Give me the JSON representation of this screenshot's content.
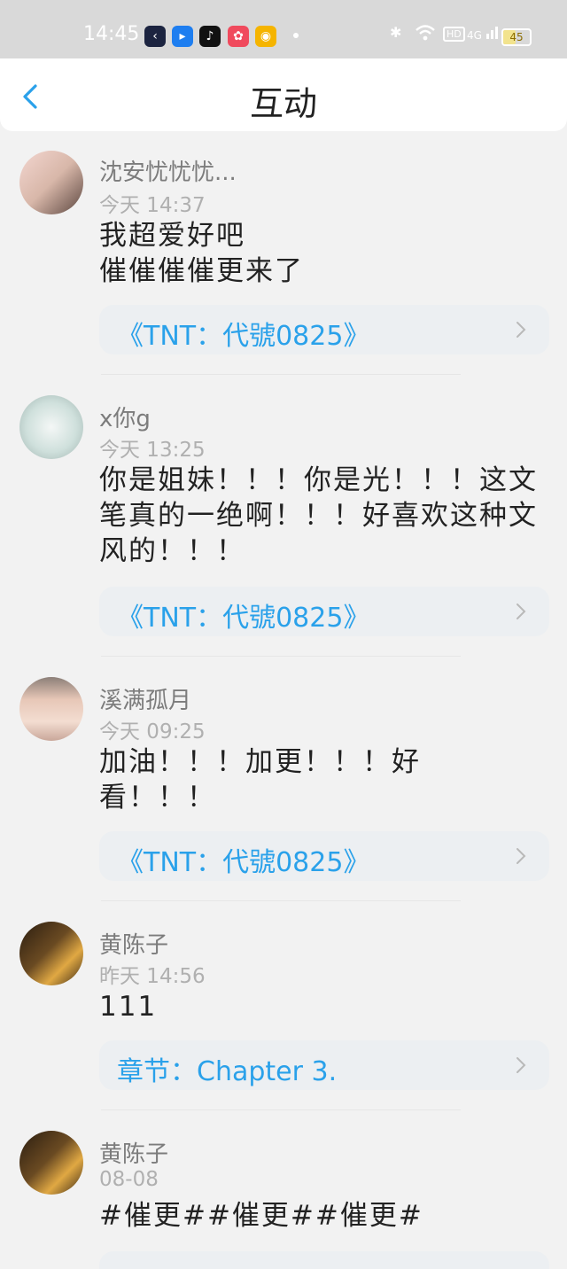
{
  "status_bar": {
    "time": "14:45",
    "apps": [
      "app-1-icon",
      "app-2-icon",
      "tiktok-icon",
      "app-4-icon",
      "weibo-icon"
    ],
    "icons": [
      "bluetooth-icon",
      "wifi-icon",
      "hd-icon",
      "signal-4g-icon"
    ],
    "hd": "HD",
    "net": "4G",
    "battery": "45"
  },
  "header": {
    "title": "互动",
    "back_icon": "chevron-left-icon"
  },
  "colors": {
    "accent": "#2aa1ea",
    "link_bg": "#eceff2",
    "page_bg": "#f2f2f2"
  },
  "feed": [
    {
      "username": "沈安忧忧忧...",
      "time": "今天 14:37",
      "content": "我超爱好吧\n催催催催更来了",
      "link": "《TNT：代號0825》"
    },
    {
      "username": "x你g",
      "time": "今天 13:25",
      "content": "你是姐妹！！！你是光！！！这文笔真的一绝啊！！！好喜欢这种文风的！！！",
      "link": "《TNT：代號0825》"
    },
    {
      "username": "溪满孤月",
      "time": "今天 09:25",
      "content": "加油！！！加更！！！好看！！！",
      "link": "《TNT：代號0825》"
    },
    {
      "username": "黄陈子",
      "time": "昨天 14:56",
      "content": "111",
      "link": "章节：Chapter 3."
    },
    {
      "username": "黄陈子",
      "time": "08-08",
      "content": "#催更##催更##催更#",
      "link": ""
    }
  ]
}
